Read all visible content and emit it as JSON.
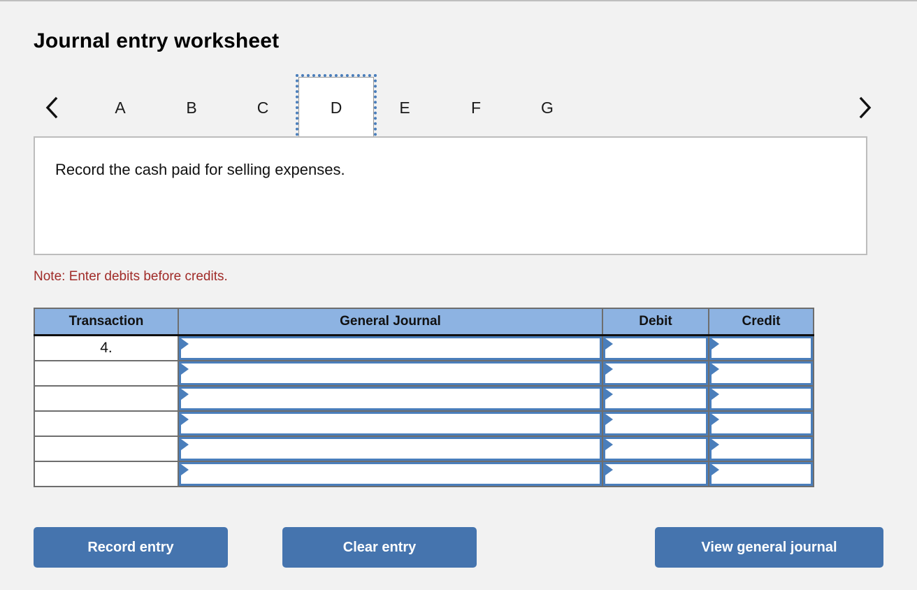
{
  "page": {
    "title": "Journal entry worksheet",
    "note": "Note: Enter debits before credits.",
    "description": "Record the cash paid for selling expenses."
  },
  "colors": {
    "accent_blue": "#4a7ebb",
    "button_blue": "#4574ae",
    "header_blue": "#8db3e2",
    "note_red": "#a02b28",
    "page_bg": "#f2f2f2"
  },
  "tabs": {
    "prev_icon": "chevron-left-icon",
    "next_icon": "chevron-right-icon",
    "active": "D",
    "items": [
      {
        "label": "A"
      },
      {
        "label": "B"
      },
      {
        "label": "C"
      },
      {
        "label": "D"
      },
      {
        "label": "E"
      },
      {
        "label": "F"
      },
      {
        "label": "G"
      }
    ]
  },
  "table": {
    "headers": {
      "transaction": "Transaction",
      "general_journal": "General Journal",
      "debit": "Debit",
      "credit": "Credit"
    },
    "rows": [
      {
        "transaction": "4.",
        "general_journal": "",
        "debit": "",
        "credit": ""
      },
      {
        "transaction": "",
        "general_journal": "",
        "debit": "",
        "credit": ""
      },
      {
        "transaction": "",
        "general_journal": "",
        "debit": "",
        "credit": ""
      },
      {
        "transaction": "",
        "general_journal": "",
        "debit": "",
        "credit": ""
      },
      {
        "transaction": "",
        "general_journal": "",
        "debit": "",
        "credit": ""
      },
      {
        "transaction": "",
        "general_journal": "",
        "debit": "",
        "credit": ""
      }
    ]
  },
  "buttons": {
    "record": "Record entry",
    "clear": "Clear entry",
    "view": "View general journal"
  }
}
